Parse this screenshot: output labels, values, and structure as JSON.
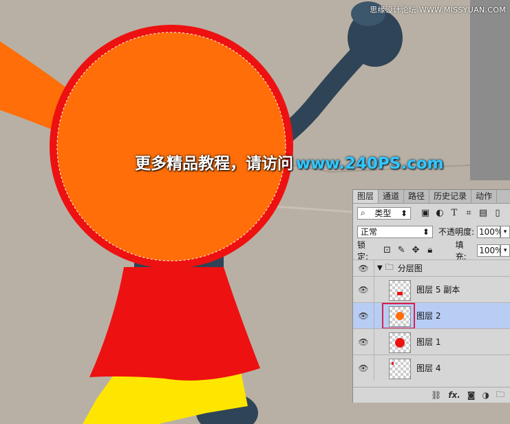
{
  "watermark": "思缘设计论坛 WWW.MISSYUAN.COM",
  "overlay": {
    "text_cn": "更多精品教程，请访问",
    "text_url": "www.240PS.com"
  },
  "colors": {
    "orange": "#ff6e08",
    "red": "#ee1111",
    "yellow": "#ffe600",
    "navy": "#2f4457",
    "panel_bg": "#d6d6d6",
    "selected_row": "#b8cdf3"
  },
  "panel": {
    "tabs": [
      "图层",
      "通道",
      "路径",
      "历史记录",
      "动作"
    ],
    "filter_label": "类型",
    "filter_icons": [
      "image-icon",
      "adjustment-icon",
      "text-icon",
      "shape-icon",
      "smart-object-icon"
    ],
    "blend_mode": "正常",
    "opacity_label": "不透明度:",
    "opacity_value": "100%",
    "lock_label": "锁定:",
    "fill_label": "填充:",
    "fill_value": "100%",
    "group_name": "分层图",
    "layers": [
      {
        "name": "图层 5 副本",
        "selected": false,
        "thumb": "red-small-shape"
      },
      {
        "name": "图层 2",
        "selected": true,
        "thumb": "orange-dot"
      },
      {
        "name": "图层 1",
        "selected": false,
        "thumb": "red-dot"
      },
      {
        "name": "图层 4",
        "selected": false,
        "thumb": "red-speck"
      }
    ],
    "bottom_icons": [
      "link-icon",
      "fx-icon",
      "mask-icon",
      "adjustment-layer-icon",
      "folder-icon"
    ],
    "bottom_fx": "fx."
  }
}
